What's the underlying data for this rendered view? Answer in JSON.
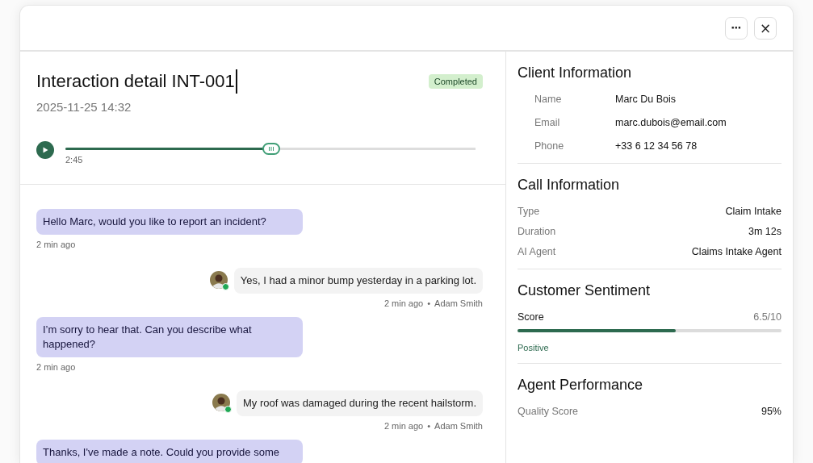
{
  "header": {
    "buttons": [
      {
        "kind": "more",
        "label": "⋯"
      },
      {
        "kind": "close",
        "label": "×"
      }
    ]
  },
  "interaction": {
    "title": "Interaction detail INT-001",
    "status": "Completed",
    "date": "2025-11-25 14:32",
    "player": {
      "level": 0.5,
      "time": "2:45"
    }
  },
  "messages": [
    {
      "kind": "agent",
      "text": "Hello Marc, would you like to report an incident?",
      "time": "2 min ago"
    },
    {
      "kind": "customer",
      "text": "Yes, I had a minor bump yesterday in a parking lot.",
      "time": "2 min ago",
      "separator": "•",
      "author": "Adam Smith",
      "online": true
    },
    {
      "kind": "agent",
      "text": "I’m sorry to hear that. Can you describe what happened?",
      "time": "2 min ago"
    },
    {
      "kind": "customer",
      "text": "My roof was damaged during the recent hailstorm.",
      "time": "2 min ago",
      "separator": "•",
      "author": "Adam Smith",
      "online": true
    },
    {
      "kind": "agent",
      "text": "Thanks, I've made a note. Could you provide some"
    }
  ],
  "client_information": {
    "title": "Client Information",
    "fields": [
      {
        "label": "Name",
        "value": "Marc Du Bois"
      },
      {
        "label": "Email",
        "value": "marc.dubois@email.com"
      },
      {
        "label": "Phone",
        "value": "+33 6 12 34 56 78"
      }
    ]
  },
  "call_information": {
    "title": "Call Information",
    "fields": [
      {
        "label": "Type",
        "value": "Claim Intake"
      },
      {
        "label": "Duration",
        "value": "3m 12s"
      },
      {
        "label": "AI Agent",
        "value": "Claims Intake Agent"
      }
    ]
  },
  "customer_sentiment": {
    "title": "Customer Sentiment",
    "label": "Score",
    "reading": "6.5/10",
    "level": 0.6,
    "verdict": "Positive"
  },
  "agent_performance": {
    "title": "Agent Performance",
    "fields": [
      {
        "label": "Quality Score",
        "value": "95%"
      }
    ]
  }
}
